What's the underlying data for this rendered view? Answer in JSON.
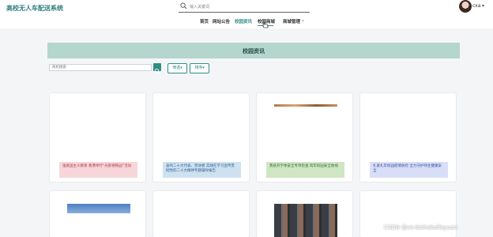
{
  "header": {
    "brand": "高校无人车配送系统",
    "search": {
      "placeholder": "输入关键词"
    },
    "user": {
      "name": "cxa"
    }
  },
  "nav": {
    "items": [
      {
        "label": "首页"
      },
      {
        "label": "网站公告"
      },
      {
        "label": "校园资讯",
        "active": true
      },
      {
        "label": "校园商城"
      },
      {
        "label": "商城管理",
        "has_dropdown": true
      }
    ]
  },
  "main": {
    "banner_title": "校园资讯",
    "filter": {
      "placeholder": "商机搜索",
      "filter_label": "筛选",
      "sort_label": "排序"
    },
    "cards": [
      {
        "caption": "强爱国主义教育 香港举行“光影德铁园”活动",
        "tone": "pink"
      },
      {
        "caption": "奋的二十大代表、劳动者 实践在学习宣传贯彻党的二十大精神专题辅导报告",
        "tone": "blue"
      },
      {
        "caption": "我县开学季安全专项检查 筑牢校园安全防线",
        "tone": "green"
      },
      {
        "caption": "扎紧扎牢校园疫情防控 全力守护师生健康安全",
        "tone": "lav"
      },
      {
        "caption": ""
      },
      {
        "caption": ""
      },
      {
        "caption": ""
      },
      {
        "caption": ""
      }
    ]
  },
  "watermark": "CSDN @vx-bishekaifayuan",
  "colors": {
    "accent": "#2f8f86",
    "banner": "#b4d6cd"
  }
}
